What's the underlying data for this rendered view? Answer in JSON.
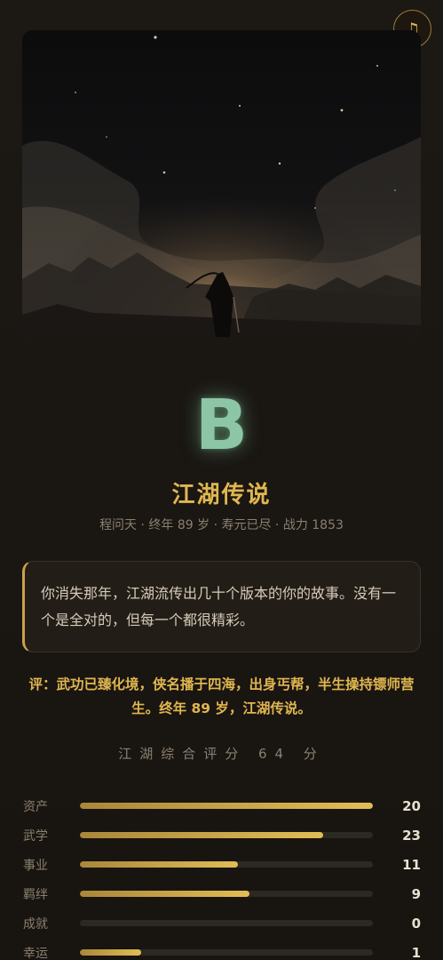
{
  "music_button": {
    "icon": "music-note-icon",
    "glyph": "♫"
  },
  "result": {
    "grade": "B",
    "title": "江湖传说",
    "meta": "程问天 · 终年 89 岁 · 寿元已尽 · 战力 1853"
  },
  "epilogue": "你消失那年，江湖流传出几十个版本的你的故事。没有一个是全对的，但每一个都很精彩。",
  "verdict": "评：武功已臻化境，侠名播于四海，出身丐帮，半生操持镖师营生。终年 89 岁，江湖传说。",
  "score_text": "江湖综合评分 64 分",
  "colors": {
    "accent_gold": "#e0b650",
    "grade_green": "#8cc6a6",
    "background": "#1a1612"
  },
  "stats": [
    {
      "label": "资产",
      "value": "20",
      "fill": 1.0
    },
    {
      "label": "武学",
      "value": "23",
      "fill": 0.83
    },
    {
      "label": "事业",
      "value": "11",
      "fill": 0.54
    },
    {
      "label": "羁绊",
      "value": "9",
      "fill": 0.58
    },
    {
      "label": "成就",
      "value": "0",
      "fill": 0.0
    },
    {
      "label": "幸运",
      "value": "1",
      "fill": 0.21
    }
  ]
}
